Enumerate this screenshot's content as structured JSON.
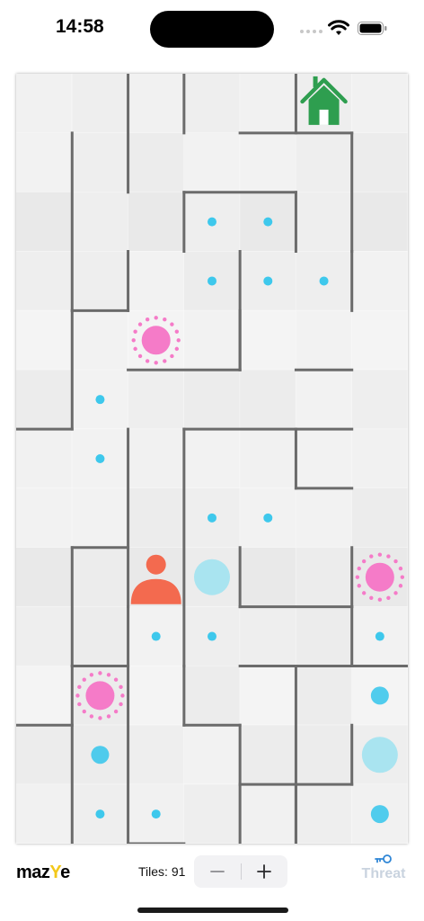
{
  "status_bar": {
    "time": "14:58"
  },
  "game": {
    "cols": 7,
    "rows": 13,
    "goal_icon": "house-icon",
    "player_icon": "person-icon",
    "colors": {
      "wall": "#6b6b6b",
      "dot": "#3ec8ec",
      "orb": "#a9e4f0",
      "hazard": "#f57bc8",
      "player": "#f36a4f",
      "home": "#2e9e4f"
    },
    "goal": {
      "col": 5,
      "row": 0
    },
    "player": {
      "col": 2,
      "row": 8
    },
    "dots": [
      [
        3,
        2
      ],
      [
        4,
        2
      ],
      [
        3,
        3
      ],
      [
        4,
        3
      ],
      [
        5,
        3
      ],
      [
        1,
        5
      ],
      [
        1,
        6
      ],
      [
        3,
        7
      ],
      [
        4,
        7
      ],
      [
        2,
        9
      ],
      [
        3,
        9
      ],
      [
        6,
        9
      ],
      [
        1,
        12
      ],
      [
        2,
        12
      ]
    ],
    "medium_dots": [
      [
        6,
        10
      ],
      [
        1,
        11
      ],
      [
        6,
        12
      ]
    ],
    "large_orbs": [
      [
        3,
        8
      ],
      [
        6,
        11
      ]
    ],
    "hazards": [
      [
        2,
        4
      ],
      [
        6,
        8
      ],
      [
        1,
        10
      ]
    ],
    "walls_h": [
      [
        4,
        1,
        1
      ],
      [
        5,
        1,
        1
      ],
      [
        3,
        2,
        1
      ],
      [
        4,
        2,
        1
      ],
      [
        1,
        4,
        1
      ],
      [
        4,
        5,
        1
      ],
      [
        5,
        5,
        1
      ],
      [
        1,
        6,
        1
      ],
      [
        3,
        6,
        1
      ],
      [
        4,
        6,
        1
      ],
      [
        5,
        6,
        1
      ],
      [
        4,
        8,
        1
      ],
      [
        5,
        8,
        1
      ],
      [
        0,
        9,
        1
      ],
      [
        1,
        9,
        1
      ],
      [
        2,
        9,
        1
      ],
      [
        4,
        10,
        1
      ],
      [
        5,
        10,
        1
      ],
      [
        6,
        10,
        1
      ],
      [
        3,
        11,
        1
      ],
      [
        0,
        11,
        1
      ],
      [
        4,
        12,
        1
      ],
      [
        5,
        12,
        1
      ],
      [
        2,
        13,
        1
      ],
      [
        1,
        14,
        1
      ],
      [
        2,
        14,
        1
      ],
      [
        6,
        14,
        1
      ],
      [
        4,
        15,
        1
      ],
      [
        5,
        15,
        1
      ],
      [
        4,
        16,
        1
      ]
    ],
    "walls_v": [
      [
        2,
        0,
        2
      ],
      [
        3,
        0,
        1
      ],
      [
        5,
        0,
        1
      ],
      [
        1,
        1,
        3
      ],
      [
        6,
        1,
        2
      ],
      [
        3,
        2,
        1
      ],
      [
        5,
        2,
        1
      ],
      [
        2,
        3,
        1
      ],
      [
        4,
        3,
        2
      ],
      [
        6,
        3,
        1
      ],
      [
        1,
        4,
        2
      ],
      [
        4,
        4,
        1
      ],
      [
        2,
        5,
        4
      ],
      [
        5,
        5,
        1
      ],
      [
        3,
        6,
        3
      ],
      [
        6,
        6,
        1
      ],
      [
        1,
        7,
        2
      ],
      [
        4,
        7,
        1
      ],
      [
        6,
        7,
        1
      ],
      [
        1,
        8,
        2
      ],
      [
        3,
        8,
        1
      ],
      [
        2,
        9,
        3
      ],
      [
        6,
        9,
        1
      ],
      [
        1,
        10,
        3
      ],
      [
        3,
        10,
        1
      ],
      [
        5,
        10,
        2
      ],
      [
        4,
        11,
        2
      ],
      [
        6,
        11,
        1
      ],
      [
        4,
        12,
        1
      ],
      [
        5,
        12,
        1
      ]
    ]
  },
  "bottom_bar": {
    "logo_main": "maz",
    "logo_accent": "Y",
    "logo_tail": "e",
    "tiles_label": "Tiles: 91",
    "minus_icon": "minus-icon",
    "plus_icon": "plus-icon",
    "threat_icon": "key-icon",
    "threat_label": "Threat"
  }
}
